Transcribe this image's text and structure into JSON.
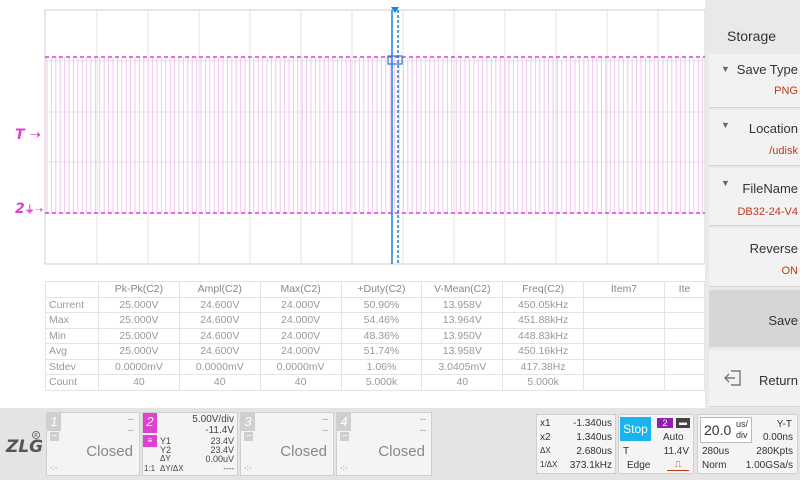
{
  "markers": {
    "trigger": "T",
    "channel2": "2"
  },
  "measurements": {
    "headers": [
      "",
      "Pk-Pk(C2)",
      "Ampl(C2)",
      "Max(C2)",
      "+Duty(C2)",
      "V-Mean(C2)",
      "Freq(C2)",
      "Item7",
      "Ite"
    ],
    "rows": [
      [
        "Current",
        "25.000V",
        "24.600V",
        "24.000V",
        "50.90%",
        "13.958V",
        "450.05kHz",
        "",
        ""
      ],
      [
        "Max",
        "25.000V",
        "24.600V",
        "24.000V",
        "54.46%",
        "13.964V",
        "451.88kHz",
        "",
        ""
      ],
      [
        "Min",
        "25.000V",
        "24.600V",
        "24.000V",
        "48.36%",
        "13.950V",
        "448.83kHz",
        "",
        ""
      ],
      [
        "Avg",
        "25.000V",
        "24.600V",
        "24.000V",
        "51.74%",
        "13.958V",
        "450.16kHz",
        "",
        ""
      ],
      [
        "Stdev",
        "0.0000mV",
        "0.0000mV",
        "0.0000mV",
        "1.06%",
        "3.0405mV",
        "417.38Hz",
        "",
        ""
      ],
      [
        "Count",
        "40",
        "40",
        "40",
        "5.000k",
        "40",
        "5.000k",
        "",
        ""
      ]
    ]
  },
  "panel": {
    "title": "Storage",
    "save_type_label": "Save Type",
    "save_type_value": "PNG",
    "location_label": "Location",
    "location_value": "/udisk",
    "filename_label": "FileName",
    "filename_value": "DB32-24-V4",
    "reverse_label": "Reverse",
    "reverse_value": "ON",
    "save_label": "Save",
    "return_label": "Return"
  },
  "channels": {
    "ch1": {
      "num": "1",
      "dash1": "--",
      "dash2": "--",
      "status": "Closed",
      "dots": "-:-"
    },
    "ch2": {
      "num": "2",
      "scale": "5.00V/div",
      "offset": "-11.4V",
      "y1": "Y1",
      "y1_val": "23.4V",
      "y2": "Y2",
      "y2_val": "23.4V",
      "dy": "ΔY",
      "dy_val": "0.00uV",
      "ratio": "1:1",
      "dydx": "ΔY/ΔX",
      "dydx_val": "----"
    },
    "ch3": {
      "num": "3",
      "dash1": "--",
      "dash2": "--",
      "status": "Closed",
      "dots": "-:-"
    },
    "ch4": {
      "num": "4",
      "dash1": "--",
      "dash2": "--",
      "status": "Closed",
      "dots": "-:-"
    }
  },
  "cursor": {
    "x1_label": "x1",
    "x1_val": "-1.340us",
    "x2_label": "x2",
    "x2_val": "1.340us",
    "dx_label": "ΔX",
    "dx_val": "2.680us",
    "inv_label": "1/ΔX",
    "inv_val": "373.1kHz"
  },
  "trigger": {
    "state": "Stop",
    "source": "2",
    "mode": "Auto",
    "t_label": "T",
    "t_val": "11.4V",
    "type": "Edge"
  },
  "timebase": {
    "value": "20.0",
    "unit_top": "us/",
    "unit_bottom": "div",
    "mode": "Y-T",
    "offset": "0.00ns",
    "depth": "280us",
    "points": "280Kpts",
    "acq": "Norm",
    "rate": "1.00GSa/s"
  },
  "colors": {
    "ch2": "#e040d0",
    "cursor": "#1e7fd8",
    "trigger_stop": "#19b4ee",
    "value_red": "#c0391b"
  }
}
